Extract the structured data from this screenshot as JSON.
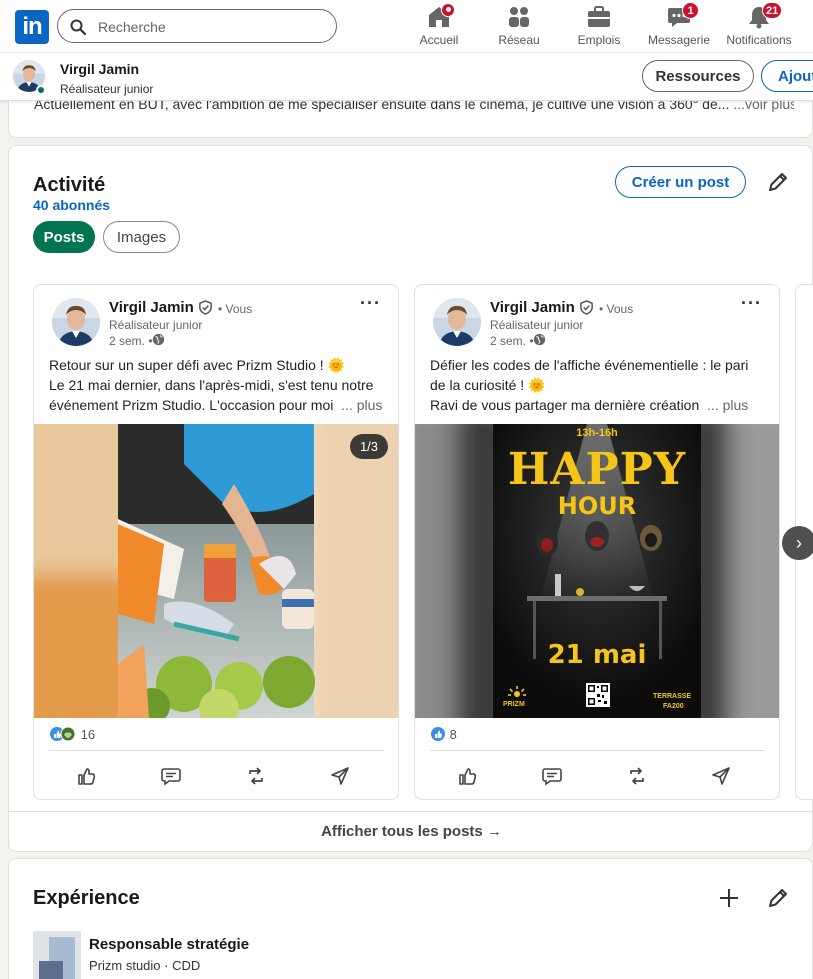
{
  "nav": {
    "logo_text": "in",
    "search_placeholder": "Recherche",
    "items": [
      {
        "label": "Accueil",
        "icon": "home-icon",
        "badge": ""
      },
      {
        "label": "Réseau",
        "icon": "network-icon",
        "badge": ""
      },
      {
        "label": "Emplois",
        "icon": "briefcase-icon",
        "badge": ""
      },
      {
        "label": "Messagerie",
        "icon": "messaging-icon",
        "badge": "1"
      },
      {
        "label": "Notifications",
        "icon": "bell-icon",
        "badge": "21"
      }
    ]
  },
  "profile_bar": {
    "name": "Virgil Jamin",
    "headline": "Réalisateur junior",
    "resources_label": "Ressources",
    "add_label": "Ajouter"
  },
  "about": {
    "text": "Actuellement en BUT, avec l'ambition de me spécialiser ensuite dans le cinéma, je cultive une vision à 360° de...",
    "more": "...voir plus"
  },
  "activity": {
    "title": "Activité",
    "followers": "40 abonnés",
    "create_post_label": "Créer un post",
    "filters": [
      "Posts",
      "Images"
    ],
    "show_all_label": "Afficher tous les posts →",
    "posts": [
      {
        "author": "Virgil Jamin",
        "you": "• Vous",
        "headline": "Réalisateur junior",
        "time": "2 sem. •",
        "lines": [
          "Retour sur un super défi avec Prizm Studio ! 🌞",
          "Le 21 mai dernier, dans l'après-midi, s'est tenu notre",
          "événement Prizm Studio. L'occasion pour moi"
        ],
        "more": "... plus",
        "counter": "1/3",
        "reactions": "16"
      },
      {
        "author": "Virgil Jamin",
        "you": "• Vous",
        "headline": "Réalisateur junior",
        "time": "2 sem. •",
        "lines": [
          "Défier les codes de l'affiche événementielle : le pari",
          "de la curiosité ! 🌞",
          "Ravi de vous partager ma dernière création"
        ],
        "more": "... plus",
        "poster": {
          "time": "13h-16h",
          "title1": "HAPPY",
          "title2": "HOUR",
          "date": "21 mai",
          "brand": "PRIZM",
          "venue1": "TERRASSE",
          "venue2": "FA200"
        },
        "reactions": "8"
      }
    ]
  },
  "experience": {
    "title": "Expérience",
    "role": "Responsable stratégie",
    "company": "Prizm studio · CDD"
  },
  "colors": {
    "brand": "#0a66c2",
    "green": "#01754f",
    "badge_red": "#cb112d",
    "poster_yellow": "#f5c518"
  }
}
